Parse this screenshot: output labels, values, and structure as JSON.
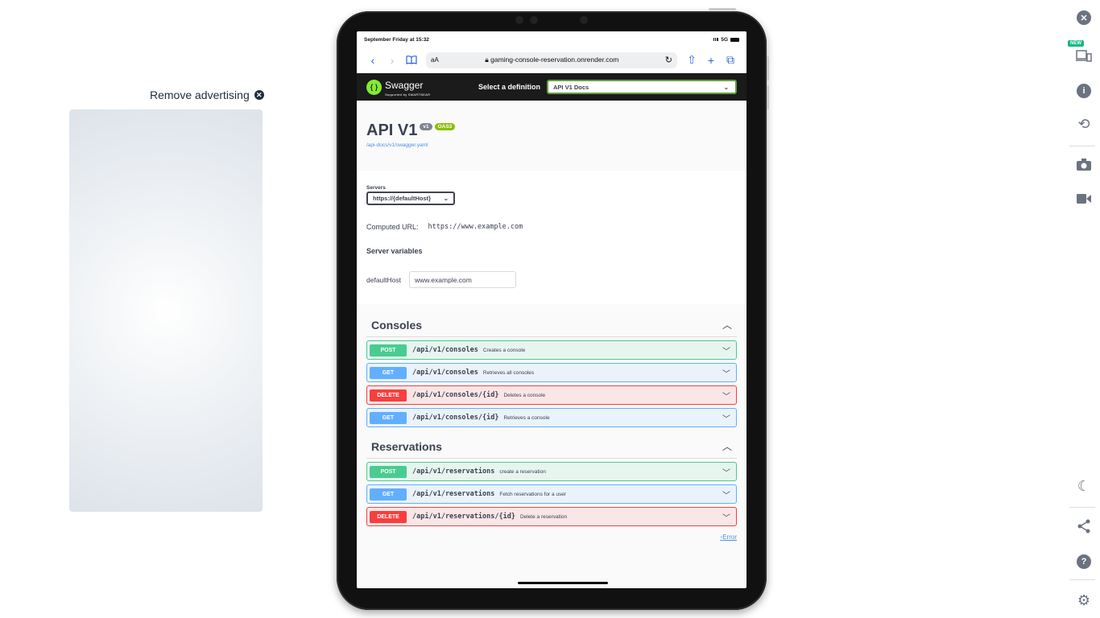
{
  "ad": {
    "remove_label": "Remove advertising",
    "remove_icon": "close-circle-icon"
  },
  "right_toolbar": {
    "new_badge": "NEW",
    "icons": [
      "close-circle-icon",
      "device-icon",
      "info-icon",
      "rotate-icon",
      "camera-icon",
      "video-icon",
      "moon-icon",
      "share-icon",
      "help-icon",
      "gear-icon"
    ]
  },
  "status_bar": {
    "time": "September Friday at 15:32",
    "network": "5G"
  },
  "safari": {
    "text_size": "aA",
    "url": "gaming-console-reservation.onrender.com"
  },
  "swagger": {
    "logo_name": "Swagger",
    "logo_sub": "Supported by SMARTBEAR",
    "definition_label": "Select a definition",
    "definition_value": "API V1 Docs"
  },
  "info": {
    "title": "API V1",
    "version_badge": "v1",
    "oas_badge": "OAS3",
    "spec_link": "/api-docs/v1/swagger.yaml"
  },
  "servers": {
    "label": "Servers",
    "selected": "https://{defaultHost}",
    "computed_label": "Computed URL:",
    "computed_value": "https://www.example.com",
    "variables_title": "Server variables",
    "variable_name": "defaultHost",
    "variable_value": "www.example.com"
  },
  "tags": [
    {
      "name": "Consoles",
      "operations": [
        {
          "method": "POST",
          "path": "/api/v1/consoles",
          "summary": "Creates a console"
        },
        {
          "method": "GET",
          "path": "/api/v1/consoles",
          "summary": "Retrieves all consoles"
        },
        {
          "method": "DELETE",
          "path": "/api/v1/consoles/{id}",
          "summary": "Deletes a console"
        },
        {
          "method": "GET",
          "path": "/api/v1/consoles/{id}",
          "summary": "Retrieves a console"
        }
      ]
    },
    {
      "name": "Reservations",
      "operations": [
        {
          "method": "POST",
          "path": "/api/v1/reservations",
          "summary": "create a reservation"
        },
        {
          "method": "GET",
          "path": "/api/v1/reservations",
          "summary": "Fetch reservations for a user"
        },
        {
          "method": "DELETE",
          "path": "/api/v1/reservations/{id}",
          "summary": "Delete a reservation"
        }
      ]
    }
  ],
  "validator_badge": "Error"
}
